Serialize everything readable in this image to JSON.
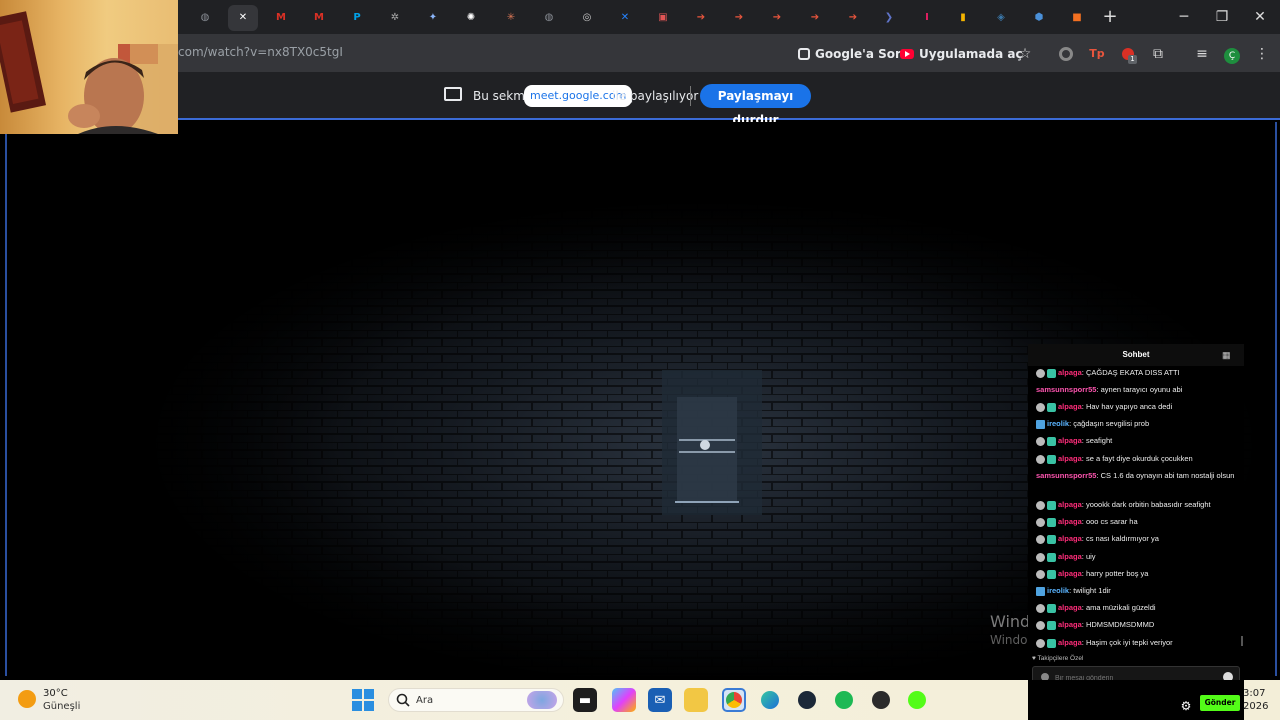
{
  "browser": {
    "url_text": "com/watch?v=nx8TX0c5tgI",
    "ask_google_label": "Google'a Sor",
    "open_in_app_label": "Uygulamada aç",
    "extension_badge": "1",
    "profile_initial": "Ç",
    "tabs": [
      {
        "icon": "globe-icon",
        "active": false
      },
      {
        "icon": "close-icon",
        "active": true
      },
      {
        "icon": "gmail-icon",
        "active": false
      },
      {
        "icon": "gmail-icon",
        "active": false
      },
      {
        "icon": "p-icon",
        "active": false
      },
      {
        "icon": "robot-icon",
        "active": false
      },
      {
        "icon": "gemini-icon",
        "active": false
      },
      {
        "icon": "openai-icon",
        "active": false
      },
      {
        "icon": "claude-icon",
        "active": false
      },
      {
        "icon": "globe-icon",
        "active": false
      },
      {
        "icon": "chrome-icon",
        "active": false
      },
      {
        "icon": "jira-icon",
        "active": false
      },
      {
        "icon": "tab-icon",
        "active": false
      },
      {
        "icon": "arrow-icon",
        "active": false
      },
      {
        "icon": "arrow-icon",
        "active": false
      },
      {
        "icon": "arrow-icon",
        "active": false
      },
      {
        "icon": "arrow-icon",
        "active": false
      },
      {
        "icon": "arrow-icon",
        "active": false
      },
      {
        "icon": "chevron-icon",
        "active": false
      },
      {
        "icon": "italic-i-icon",
        "active": false
      },
      {
        "icon": "bars-icon",
        "active": false
      },
      {
        "icon": "python-icon",
        "active": false
      },
      {
        "icon": "cube-icon",
        "active": false
      },
      {
        "icon": "orange-app-icon",
        "active": false
      }
    ]
  },
  "share_bar": {
    "prefix": "Bu sekme",
    "domain": "meet.google.com",
    "suffix": "ile paylaşılıyor",
    "stop_label": "Paylaşmayı durdur"
  },
  "chat": {
    "title": "Sohbet",
    "followers_only": "♥ Takipçilere Özel",
    "input_placeholder": "Bir mesaj gönderin",
    "send_label": "Gönder",
    "messages": [
      {
        "user": "alpaga",
        "sep": ": ",
        "text": "ÇAĞDAŞ EKATA DISS ATTI",
        "badge": "double",
        "color": "pink"
      },
      {
        "user": "samsunnsporr55",
        "sep": ": ",
        "text": "aynen tarayıcı oyunu abi",
        "badge": "none",
        "color": "mag"
      },
      {
        "user": "alpaga",
        "sep": ": ",
        "text": "Hav hav yapıyo anca dedi",
        "badge": "double",
        "color": "pink"
      },
      {
        "user": "ireolik",
        "sep": ": ",
        "text": "çağdaşın sevgilisi prob",
        "badge": "blue",
        "color": "blue"
      },
      {
        "user": "alpaga",
        "sep": ": ",
        "text": "seafight",
        "badge": "double",
        "color": "pink"
      },
      {
        "user": "alpaga",
        "sep": ": ",
        "text": "se a fayt diye okurduk çocukken",
        "badge": "double",
        "color": "pink"
      },
      {
        "user": "samsunnsporr55",
        "sep": ": ",
        "text": "CS 1.6 da oynayın abi tam nostalji olsun",
        "badge": "none",
        "color": "mag"
      },
      {
        "user": "alpaga",
        "sep": ": ",
        "text": "yoookk dark orbitin babasıdır seafight",
        "badge": "double",
        "color": "pink"
      },
      {
        "user": "alpaga",
        "sep": ": ",
        "text": "ooo cs sarar ha",
        "badge": "double",
        "color": "pink"
      },
      {
        "user": "alpaga",
        "sep": ": ",
        "text": "cs nası kaldırmıyor ya",
        "badge": "double",
        "color": "pink"
      },
      {
        "user": "alpaga",
        "sep": ": ",
        "text": "uiy",
        "badge": "double",
        "color": "pink"
      },
      {
        "user": "alpaga",
        "sep": ": ",
        "text": "harry potter boş ya",
        "badge": "double",
        "color": "pink"
      },
      {
        "user": "ireolik",
        "sep": ": ",
        "text": "twilight 1dir",
        "badge": "blue",
        "color": "blue"
      },
      {
        "user": "alpaga",
        "sep": ": ",
        "text": "ama müzikali güzeldi",
        "badge": "double",
        "color": "pink"
      },
      {
        "user": "alpaga",
        "sep": ": ",
        "text": "HDMSMDMSDMMD",
        "badge": "double",
        "color": "pink"
      },
      {
        "user": "alpaga",
        "sep": ": ",
        "text": "Haşim çok iyi tepki veriyor",
        "badge": "double",
        "color": "pink"
      }
    ]
  },
  "watermark": {
    "line1": "Wind",
    "line2": "Windo"
  },
  "taskbar": {
    "temperature": "30°C",
    "condition": "Güneşli",
    "search_label": "Ara",
    "time": "3:07",
    "date": "2026"
  }
}
